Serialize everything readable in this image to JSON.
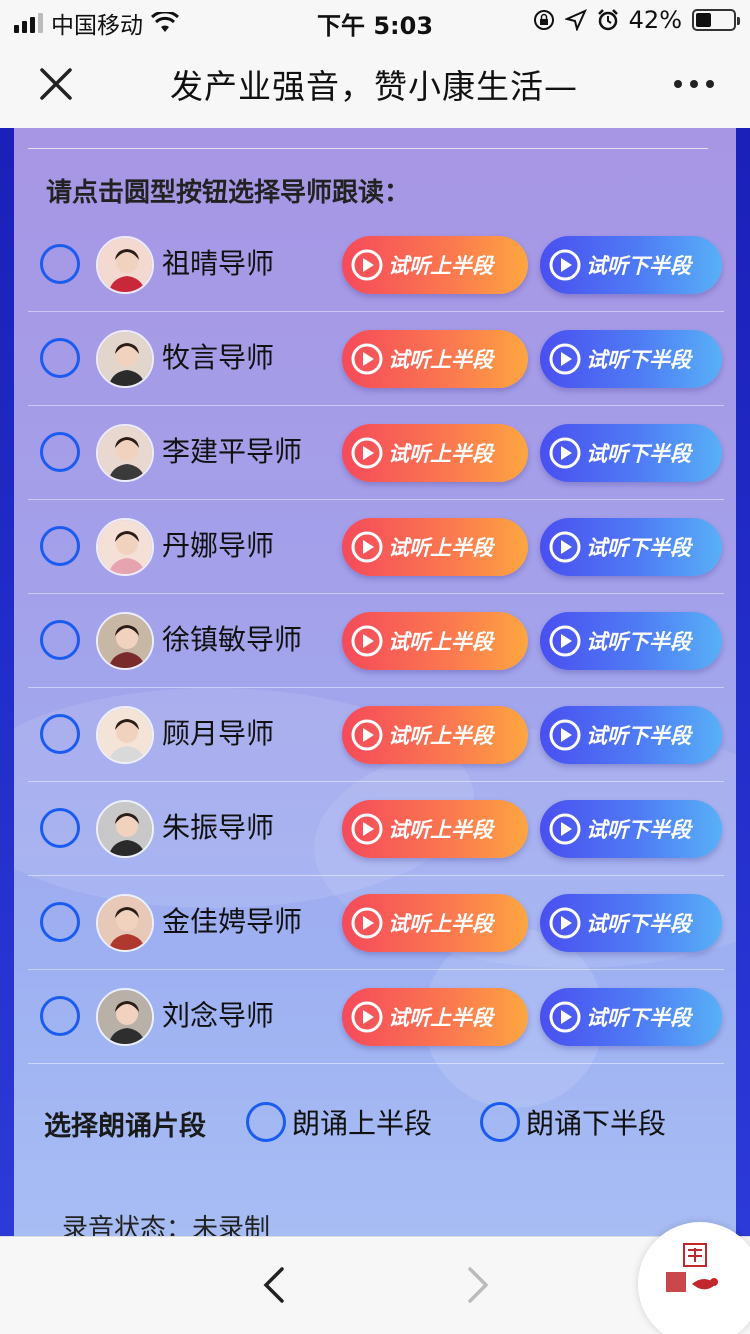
{
  "status_bar": {
    "carrier": "中国移动",
    "time": "下午 5:03",
    "battery": "42%",
    "battery_level": 0.42
  },
  "nav": {
    "title": "发产业强音，赞小康生活—"
  },
  "instruction": "请点击圆型按钮选择导师跟读：",
  "buttons": {
    "listen_first": "试听上半段",
    "listen_second": "试听下半段"
  },
  "tutors": [
    {
      "name": "祖晴导师"
    },
    {
      "name": "牧言导师"
    },
    {
      "name": "李建平导师"
    },
    {
      "name": "丹娜导师"
    },
    {
      "name": "徐镇敏导师"
    },
    {
      "name": "顾月导师"
    },
    {
      "name": "朱振导师"
    },
    {
      "name": "金佳娉导师"
    },
    {
      "name": "刘念导师"
    }
  ],
  "segment": {
    "label": "选择朗诵片段",
    "option_first": "朗诵上半段",
    "option_second": "朗诵下半段"
  },
  "record_status": "录音状态：未录制",
  "colors": {
    "accent_blue": "#1a5cf0",
    "listen_first_gradient": "#f54a5a",
    "listen_second_gradient": "#4a4ff0",
    "panel": "#a796e4"
  },
  "icons": {
    "close": "close-icon",
    "more": "more-icon",
    "back": "chevron-left-icon",
    "forward": "chevron-right-icon",
    "play": "play-icon"
  }
}
